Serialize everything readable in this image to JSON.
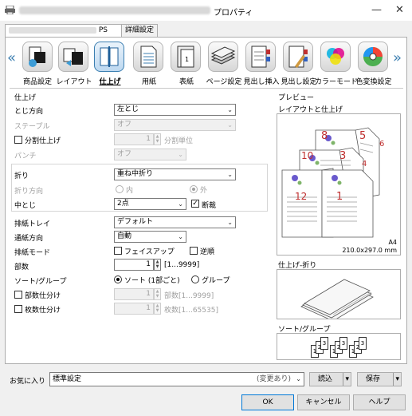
{
  "window": {
    "title_suffix": "プロパティ",
    "minimize": "—",
    "close": "✕"
  },
  "tabs": [
    {
      "label": "PS"
    },
    {
      "label": "詳細設定"
    }
  ],
  "toolbar": {
    "items": [
      {
        "label": "商品設定",
        "icon": "product-settings-icon"
      },
      {
        "label": "レイアウト",
        "icon": "layout-icon"
      },
      {
        "label": "仕上げ",
        "icon": "finishing-icon",
        "active": true
      },
      {
        "label": "用紙",
        "icon": "paper-icon"
      },
      {
        "label": "表紙",
        "icon": "cover-icon"
      },
      {
        "label": "ページ設定",
        "icon": "page-settings-icon"
      },
      {
        "label": "見出し挿入",
        "icon": "tab-insert-icon"
      },
      {
        "label": "見出し設定",
        "icon": "tab-settings-icon"
      },
      {
        "label": "カラーモード",
        "icon": "color-mode-icon"
      },
      {
        "label": "色変換設定",
        "icon": "color-conversion-icon"
      }
    ],
    "prev": "«",
    "next": "»"
  },
  "finishing": {
    "section_title": "仕上げ",
    "binding_label": "とじ方向",
    "binding_value": "左とじ",
    "staple_label": "ステープル",
    "staple_value": "オフ",
    "split_label": "分割仕上げ",
    "split_value": "1",
    "split_unit": "分割単位",
    "punch_label": "パンチ",
    "punch_value": "オフ",
    "fold_label": "折り",
    "fold_value": "重ね中折り",
    "fold_dir_label": "折り方向",
    "fold_dir_in": "内",
    "fold_dir_out": "外",
    "saddle_label": "中とじ",
    "saddle_value": "2点",
    "trim_label": "断裁"
  },
  "output": {
    "tray_label": "排紙トレイ",
    "tray_value": "デフォルト",
    "feed_label": "通紙方向",
    "feed_value": "自動",
    "mode_label": "排紙モード",
    "faceup_label": "フェイスアップ",
    "reverse_label": "逆順",
    "copies_label": "部数",
    "copies_value": "1",
    "copies_range": "[1...9999]",
    "sort_label": "ソート/グループ",
    "sort_option": "ソート (1部ごと)",
    "group_option": "グループ",
    "copy_split_label": "部数仕分け",
    "copy_split_value": "1",
    "copy_split_range": "部数[1...9999]",
    "sheet_split_label": "枚数仕分け",
    "sheet_split_value": "1",
    "sheet_split_range": "枚数[1...65535]"
  },
  "preview": {
    "title": "プレビュー",
    "layout_title": "レイアウトと仕上げ",
    "paper_size": "A4",
    "paper_dims": "210.0x297.0 mm",
    "page_numbers": [
      "8",
      "5",
      "6",
      "10",
      "3",
      "4",
      "12",
      "1"
    ],
    "fold_title": "仕上げ-折り",
    "sort_title": "ソート/グループ",
    "sort_sets": [
      [
        "1",
        "2",
        "3"
      ],
      [
        "1",
        "2",
        "3"
      ],
      [
        "1",
        "2",
        "3"
      ]
    ]
  },
  "favorites": {
    "label": "お気に入り",
    "value": "標準設定",
    "changed": "(変更あり)",
    "load": "読込",
    "save": "保存"
  },
  "footer": {
    "ok": "OK",
    "cancel": "キャンセル",
    "help": "ヘルプ"
  }
}
